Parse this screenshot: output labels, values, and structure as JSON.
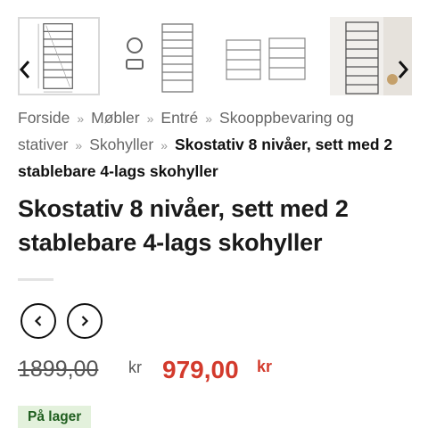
{
  "gallery": {
    "prev_icon": "chevron-left-icon",
    "next_icon": "chevron-right-icon",
    "thumbnails": [
      {
        "name": "shoe-rack-dimensions"
      },
      {
        "name": "shoe-rack-parts"
      },
      {
        "name": "shoe-rack-split-configurations"
      },
      {
        "name": "shoe-rack-in-room"
      }
    ]
  },
  "breadcrumb": {
    "items": [
      "Forside",
      "Møbler",
      "Entré",
      "Skooppbevaring og stativer",
      "Skohyller"
    ],
    "separator": "»",
    "current": "Skostativ 8 nivåer, sett med 2 stablebare 4-lags skohyller"
  },
  "product": {
    "title": "Skostativ 8 nivåer, sett med 2 stablebare 4-lags skohyller",
    "old_price": "1899,00",
    "old_currency": "kr",
    "price": "979,00",
    "currency": "kr",
    "stock_status": "På lager"
  },
  "colors": {
    "price": "#d33a2c",
    "stock_bg": "#e3f1dc",
    "stock_text": "#1f5e1f"
  }
}
